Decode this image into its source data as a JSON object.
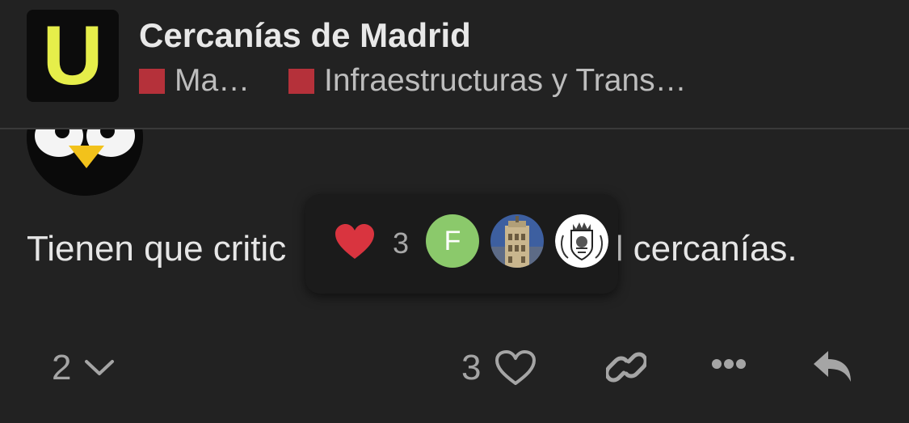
{
  "topic": {
    "logo_letter": "U",
    "title": "Cercanías de Madrid",
    "categories": [
      {
        "label": "Ma…",
        "color": "#b5313a"
      },
      {
        "label": "Infraestructuras y Trans…",
        "color": "#b5313a"
      }
    ]
  },
  "post": {
    "avatar": "penguin-avatar",
    "text": "Tienen que critic",
    "text_tail": "l cercanías."
  },
  "reactions_popup": {
    "icon": "heart-icon",
    "color": "#d9343f",
    "count": "3",
    "users": [
      {
        "initial": "F",
        "color": "#8bc96b"
      },
      {
        "avatar": "tower-avatar"
      },
      {
        "avatar": "crest-avatar"
      }
    ]
  },
  "actions": {
    "replies_count": "2",
    "likes_count": "3"
  }
}
